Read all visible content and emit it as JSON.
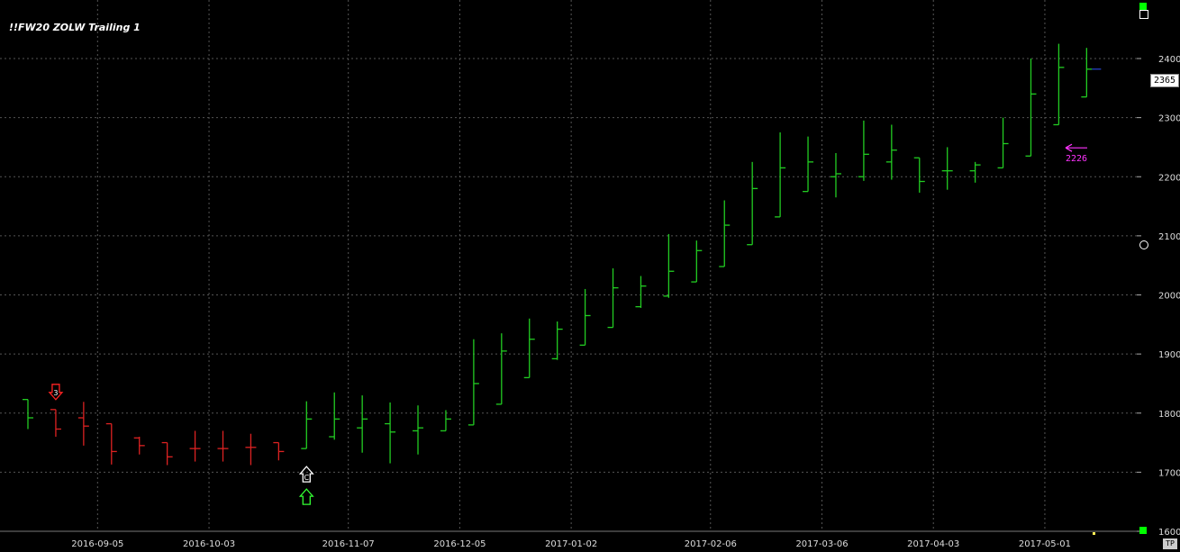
{
  "chart_title": "!!FW20 ZOLW Trailing 1",
  "last_price_label": "2365",
  "tp_label": "TP",
  "annotation": {
    "text": "2226",
    "value": 2226
  },
  "colors": {
    "bull": "#22cc22",
    "bear": "#dd2222",
    "grid": "#555555",
    "axis_text": "#dddddd",
    "annotation": "#ff33ff",
    "marker_green": "#00ff00"
  },
  "chart_data": {
    "type": "bar",
    "subtype": "ohlc",
    "ylim": [
      1600,
      2430
    ],
    "y_ticks": [
      1600,
      1700,
      1800,
      1900,
      2000,
      2100,
      2200,
      2300,
      2400
    ],
    "x_ticks": [
      "2016-09-05",
      "2016-10-03",
      "2016-11-07",
      "2016-12-05",
      "2017-01-02",
      "2017-02-06",
      "2017-03-06",
      "2017-04-03",
      "2017-05-01"
    ],
    "x_tick_index": [
      2.5,
      6.5,
      11.5,
      15.5,
      19.5,
      24.5,
      28.5,
      32.5,
      36.5
    ],
    "grid": true,
    "bars": [
      {
        "o": 1823,
        "h": 1823,
        "l": 1773,
        "c": 1792,
        "dir": "up"
      },
      {
        "o": 1806,
        "h": 1806,
        "l": 1760,
        "c": 1773,
        "dir": "down"
      },
      {
        "o": 1792,
        "h": 1819,
        "l": 1745,
        "c": 1778,
        "dir": "down"
      },
      {
        "o": 1782,
        "h": 1782,
        "l": 1713,
        "c": 1735,
        "dir": "down"
      },
      {
        "o": 1758,
        "h": 1760,
        "l": 1730,
        "c": 1745,
        "dir": "down"
      },
      {
        "o": 1750,
        "h": 1750,
        "l": 1712,
        "c": 1726,
        "dir": "down"
      },
      {
        "o": 1740,
        "h": 1770,
        "l": 1718,
        "c": 1740,
        "dir": "down"
      },
      {
        "o": 1740,
        "h": 1770,
        "l": 1718,
        "c": 1740,
        "dir": "down"
      },
      {
        "o": 1742,
        "h": 1765,
        "l": 1712,
        "c": 1742,
        "dir": "down"
      },
      {
        "o": 1750,
        "h": 1750,
        "l": 1720,
        "c": 1735,
        "dir": "down"
      },
      {
        "o": 1740,
        "h": 1820,
        "l": 1740,
        "c": 1790,
        "dir": "up"
      },
      {
        "o": 1760,
        "h": 1835,
        "l": 1755,
        "c": 1790,
        "dir": "up"
      },
      {
        "o": 1775,
        "h": 1830,
        "l": 1733,
        "c": 1790,
        "dir": "up"
      },
      {
        "o": 1782,
        "h": 1818,
        "l": 1715,
        "c": 1768,
        "dir": "up"
      },
      {
        "o": 1770,
        "h": 1813,
        "l": 1730,
        "c": 1775,
        "dir": "up"
      },
      {
        "o": 1770,
        "h": 1805,
        "l": 1770,
        "c": 1790,
        "dir": "up"
      },
      {
        "o": 1780,
        "h": 1925,
        "l": 1780,
        "c": 1850,
        "dir": "up"
      },
      {
        "o": 1815,
        "h": 1935,
        "l": 1815,
        "c": 1905,
        "dir": "up"
      },
      {
        "o": 1860,
        "h": 1960,
        "l": 1860,
        "c": 1925,
        "dir": "up"
      },
      {
        "o": 1892,
        "h": 1955,
        "l": 1890,
        "c": 1942,
        "dir": "up"
      },
      {
        "o": 1915,
        "h": 2010,
        "l": 1915,
        "c": 1965,
        "dir": "up"
      },
      {
        "o": 1945,
        "h": 2045,
        "l": 1945,
        "c": 2012,
        "dir": "up"
      },
      {
        "o": 1980,
        "h": 2032,
        "l": 1978,
        "c": 2015,
        "dir": "up"
      },
      {
        "o": 1998,
        "h": 2103,
        "l": 1995,
        "c": 2040,
        "dir": "up"
      },
      {
        "o": 2022,
        "h": 2092,
        "l": 2022,
        "c": 2075,
        "dir": "up"
      },
      {
        "o": 2048,
        "h": 2160,
        "l": 2048,
        "c": 2118,
        "dir": "up"
      },
      {
        "o": 2085,
        "h": 2225,
        "l": 2085,
        "c": 2180,
        "dir": "up"
      },
      {
        "o": 2132,
        "h": 2275,
        "l": 2132,
        "c": 2215,
        "dir": "up"
      },
      {
        "o": 2175,
        "h": 2268,
        "l": 2175,
        "c": 2225,
        "dir": "up"
      },
      {
        "o": 2200,
        "h": 2240,
        "l": 2165,
        "c": 2205,
        "dir": "up"
      },
      {
        "o": 2200,
        "h": 2295,
        "l": 2193,
        "c": 2238,
        "dir": "up"
      },
      {
        "o": 2225,
        "h": 2288,
        "l": 2195,
        "c": 2245,
        "dir": "up"
      },
      {
        "o": 2232,
        "h": 2232,
        "l": 2173,
        "c": 2192,
        "dir": "up"
      },
      {
        "o": 2210,
        "h": 2250,
        "l": 2178,
        "c": 2210,
        "dir": "up"
      },
      {
        "o": 2210,
        "h": 2225,
        "l": 2190,
        "c": 2220,
        "dir": "up"
      },
      {
        "o": 2215,
        "h": 2300,
        "l": 2215,
        "c": 2256,
        "dir": "up"
      },
      {
        "o": 2235,
        "h": 2400,
        "l": 2235,
        "c": 2340,
        "dir": "up"
      },
      {
        "o": 2288,
        "h": 2425,
        "l": 2288,
        "c": 2385,
        "dir": "up"
      },
      {
        "o": 2335,
        "h": 2418,
        "l": 2335,
        "c": 2382,
        "dir": "up"
      }
    ],
    "markers": [
      {
        "type": "down-arrow",
        "bar": 1,
        "color": "red",
        "label": "3"
      },
      {
        "type": "up-arrow",
        "bar": 10,
        "color": "white",
        "label": "C"
      },
      {
        "type": "up-arrow",
        "bar": 10,
        "color": "green",
        "label": ""
      }
    ]
  }
}
